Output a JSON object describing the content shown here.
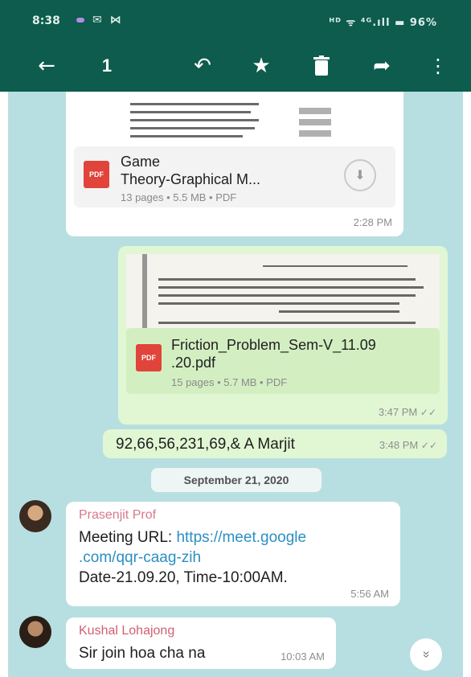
{
  "status_bar": {
    "time": "8:38",
    "app_icons": [
      "purple-pill",
      "✉",
      "⋈"
    ],
    "system_icons": "ᴴᴰ ᯤ ⁴ᴳ.ıll ▬ 96%"
  },
  "toolbar": {
    "back_glyph": "←",
    "selected_count": "1",
    "reply_glyph": "↶",
    "star_glyph": "★",
    "delete_glyph": "🗑",
    "forward_glyph": "➦",
    "more_glyph": "⋮"
  },
  "messages": [
    {
      "direction": "incoming",
      "type": "document",
      "doc_name_line1": "Game",
      "doc_name_line2": "Theory-Graphical M...",
      "doc_meta": "13 pages • 5.5 MB • PDF",
      "pdf_label": "PDF",
      "download_glyph": "⬇",
      "time": "2:28 PM"
    },
    {
      "direction": "outgoing",
      "type": "document",
      "doc_name_line1": "Friction_Problem_Sem-V_11.09",
      "doc_name_line2": ".20.pdf",
      "doc_meta": "15 pages • 5.7 MB • PDF",
      "pdf_label": "PDF",
      "time": "3:47 PM",
      "ticks": "✓✓"
    },
    {
      "direction": "outgoing",
      "type": "text",
      "text": "92,66,56,231,69,& A Marjit",
      "time": "3:48 PM",
      "ticks": "✓✓"
    },
    {
      "type": "date_separator",
      "text": "September 21, 2020"
    },
    {
      "direction": "incoming",
      "type": "text",
      "sender": "Prasenjit Prof",
      "sender_color": "#d8788e",
      "text_prefix": "Meeting URL: ",
      "link_line1": "https://meet.google",
      "link_line2": ".com/qqr-caag-zih",
      "text_line3": "Date-21.09.20, Time-10:00AM.",
      "time": "5:56 AM"
    },
    {
      "direction": "incoming",
      "type": "text",
      "sender": "Kushal Lohajong",
      "sender_color": "#d06070",
      "text": "Sir join hoa cha na",
      "time": "10:03 AM"
    }
  ],
  "scroll_down_glyph": "»",
  "colors": {
    "header": "#0d5c4d",
    "chat_background": "#b7dfe1",
    "incoming_bubble": "#ffffff",
    "outgoing_bubble": "#e1f7d4",
    "link": "#2b8fc4",
    "pdf_icon": "#e0443a"
  }
}
